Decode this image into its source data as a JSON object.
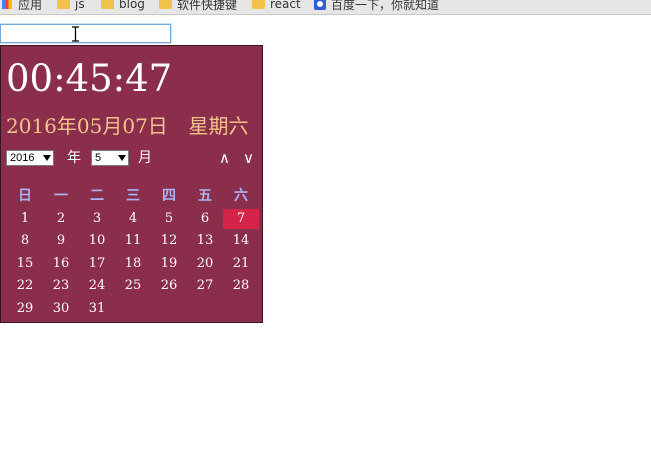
{
  "bookmarks": [
    {
      "label": "应用",
      "icon": "apps-icon"
    },
    {
      "label": "js",
      "icon": "folder-icon"
    },
    {
      "label": "blog",
      "icon": "folder-icon"
    },
    {
      "label": "软件快捷键",
      "icon": "folder-icon"
    },
    {
      "label": "react",
      "icon": "folder-icon"
    },
    {
      "label": "百度一下，你就知道",
      "icon": "baidu-icon"
    }
  ],
  "input": {
    "value": "",
    "placeholder": ""
  },
  "calendar": {
    "time": "00:45:47",
    "date_text": "2016年05月07日",
    "weekday_text": "星期六",
    "year_value": "2016",
    "year_label": "年",
    "month_value": "5",
    "month_label": "月",
    "nav_up": "∧",
    "nav_down": "∨",
    "weekdays": [
      "日",
      "一",
      "二",
      "三",
      "四",
      "五",
      "六"
    ],
    "weeks": [
      [
        "1",
        "2",
        "3",
        "4",
        "5",
        "6",
        "7"
      ],
      [
        "8",
        "9",
        "10",
        "11",
        "12",
        "13",
        "14"
      ],
      [
        "15",
        "16",
        "17",
        "18",
        "19",
        "20",
        "21"
      ],
      [
        "22",
        "23",
        "24",
        "25",
        "26",
        "27",
        "28"
      ],
      [
        "29",
        "30",
        "31",
        "",
        "",
        "",
        ""
      ]
    ],
    "today": "7",
    "colors": {
      "panel_bg": "#8b2e4c",
      "date_text": "#f2c48a",
      "weekday_header": "#a9b3f5",
      "today_bg": "#d6234a"
    }
  }
}
